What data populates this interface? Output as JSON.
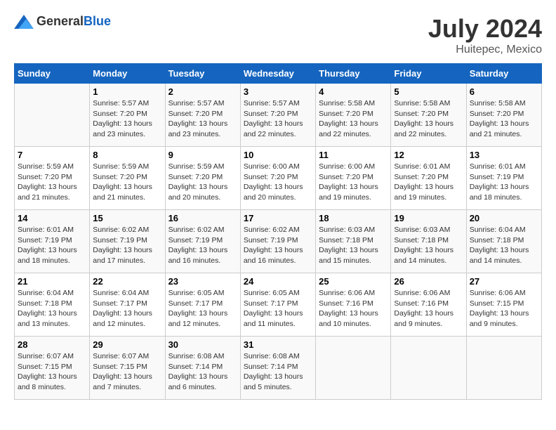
{
  "header": {
    "logo_general": "General",
    "logo_blue": "Blue",
    "month_year": "July 2024",
    "location": "Huitepec, Mexico"
  },
  "calendar": {
    "days_of_week": [
      "Sunday",
      "Monday",
      "Tuesday",
      "Wednesday",
      "Thursday",
      "Friday",
      "Saturday"
    ],
    "weeks": [
      [
        {
          "day": "",
          "info": ""
        },
        {
          "day": "1",
          "info": "Sunrise: 5:57 AM\nSunset: 7:20 PM\nDaylight: 13 hours\nand 23 minutes."
        },
        {
          "day": "2",
          "info": "Sunrise: 5:57 AM\nSunset: 7:20 PM\nDaylight: 13 hours\nand 23 minutes."
        },
        {
          "day": "3",
          "info": "Sunrise: 5:57 AM\nSunset: 7:20 PM\nDaylight: 13 hours\nand 22 minutes."
        },
        {
          "day": "4",
          "info": "Sunrise: 5:58 AM\nSunset: 7:20 PM\nDaylight: 13 hours\nand 22 minutes."
        },
        {
          "day": "5",
          "info": "Sunrise: 5:58 AM\nSunset: 7:20 PM\nDaylight: 13 hours\nand 22 minutes."
        },
        {
          "day": "6",
          "info": "Sunrise: 5:58 AM\nSunset: 7:20 PM\nDaylight: 13 hours\nand 21 minutes."
        }
      ],
      [
        {
          "day": "7",
          "info": "Sunrise: 5:59 AM\nSunset: 7:20 PM\nDaylight: 13 hours\nand 21 minutes."
        },
        {
          "day": "8",
          "info": "Sunrise: 5:59 AM\nSunset: 7:20 PM\nDaylight: 13 hours\nand 21 minutes."
        },
        {
          "day": "9",
          "info": "Sunrise: 5:59 AM\nSunset: 7:20 PM\nDaylight: 13 hours\nand 20 minutes."
        },
        {
          "day": "10",
          "info": "Sunrise: 6:00 AM\nSunset: 7:20 PM\nDaylight: 13 hours\nand 20 minutes."
        },
        {
          "day": "11",
          "info": "Sunrise: 6:00 AM\nSunset: 7:20 PM\nDaylight: 13 hours\nand 19 minutes."
        },
        {
          "day": "12",
          "info": "Sunrise: 6:01 AM\nSunset: 7:20 PM\nDaylight: 13 hours\nand 19 minutes."
        },
        {
          "day": "13",
          "info": "Sunrise: 6:01 AM\nSunset: 7:19 PM\nDaylight: 13 hours\nand 18 minutes."
        }
      ],
      [
        {
          "day": "14",
          "info": "Sunrise: 6:01 AM\nSunset: 7:19 PM\nDaylight: 13 hours\nand 18 minutes."
        },
        {
          "day": "15",
          "info": "Sunrise: 6:02 AM\nSunset: 7:19 PM\nDaylight: 13 hours\nand 17 minutes."
        },
        {
          "day": "16",
          "info": "Sunrise: 6:02 AM\nSunset: 7:19 PM\nDaylight: 13 hours\nand 16 minutes."
        },
        {
          "day": "17",
          "info": "Sunrise: 6:02 AM\nSunset: 7:19 PM\nDaylight: 13 hours\nand 16 minutes."
        },
        {
          "day": "18",
          "info": "Sunrise: 6:03 AM\nSunset: 7:18 PM\nDaylight: 13 hours\nand 15 minutes."
        },
        {
          "day": "19",
          "info": "Sunrise: 6:03 AM\nSunset: 7:18 PM\nDaylight: 13 hours\nand 14 minutes."
        },
        {
          "day": "20",
          "info": "Sunrise: 6:04 AM\nSunset: 7:18 PM\nDaylight: 13 hours\nand 14 minutes."
        }
      ],
      [
        {
          "day": "21",
          "info": "Sunrise: 6:04 AM\nSunset: 7:18 PM\nDaylight: 13 hours\nand 13 minutes."
        },
        {
          "day": "22",
          "info": "Sunrise: 6:04 AM\nSunset: 7:17 PM\nDaylight: 13 hours\nand 12 minutes."
        },
        {
          "day": "23",
          "info": "Sunrise: 6:05 AM\nSunset: 7:17 PM\nDaylight: 13 hours\nand 12 minutes."
        },
        {
          "day": "24",
          "info": "Sunrise: 6:05 AM\nSunset: 7:17 PM\nDaylight: 13 hours\nand 11 minutes."
        },
        {
          "day": "25",
          "info": "Sunrise: 6:06 AM\nSunset: 7:16 PM\nDaylight: 13 hours\nand 10 minutes."
        },
        {
          "day": "26",
          "info": "Sunrise: 6:06 AM\nSunset: 7:16 PM\nDaylight: 13 hours\nand 9 minutes."
        },
        {
          "day": "27",
          "info": "Sunrise: 6:06 AM\nSunset: 7:15 PM\nDaylight: 13 hours\nand 9 minutes."
        }
      ],
      [
        {
          "day": "28",
          "info": "Sunrise: 6:07 AM\nSunset: 7:15 PM\nDaylight: 13 hours\nand 8 minutes."
        },
        {
          "day": "29",
          "info": "Sunrise: 6:07 AM\nSunset: 7:15 PM\nDaylight: 13 hours\nand 7 minutes."
        },
        {
          "day": "30",
          "info": "Sunrise: 6:08 AM\nSunset: 7:14 PM\nDaylight: 13 hours\nand 6 minutes."
        },
        {
          "day": "31",
          "info": "Sunrise: 6:08 AM\nSunset: 7:14 PM\nDaylight: 13 hours\nand 5 minutes."
        },
        {
          "day": "",
          "info": ""
        },
        {
          "day": "",
          "info": ""
        },
        {
          "day": "",
          "info": ""
        }
      ]
    ]
  }
}
